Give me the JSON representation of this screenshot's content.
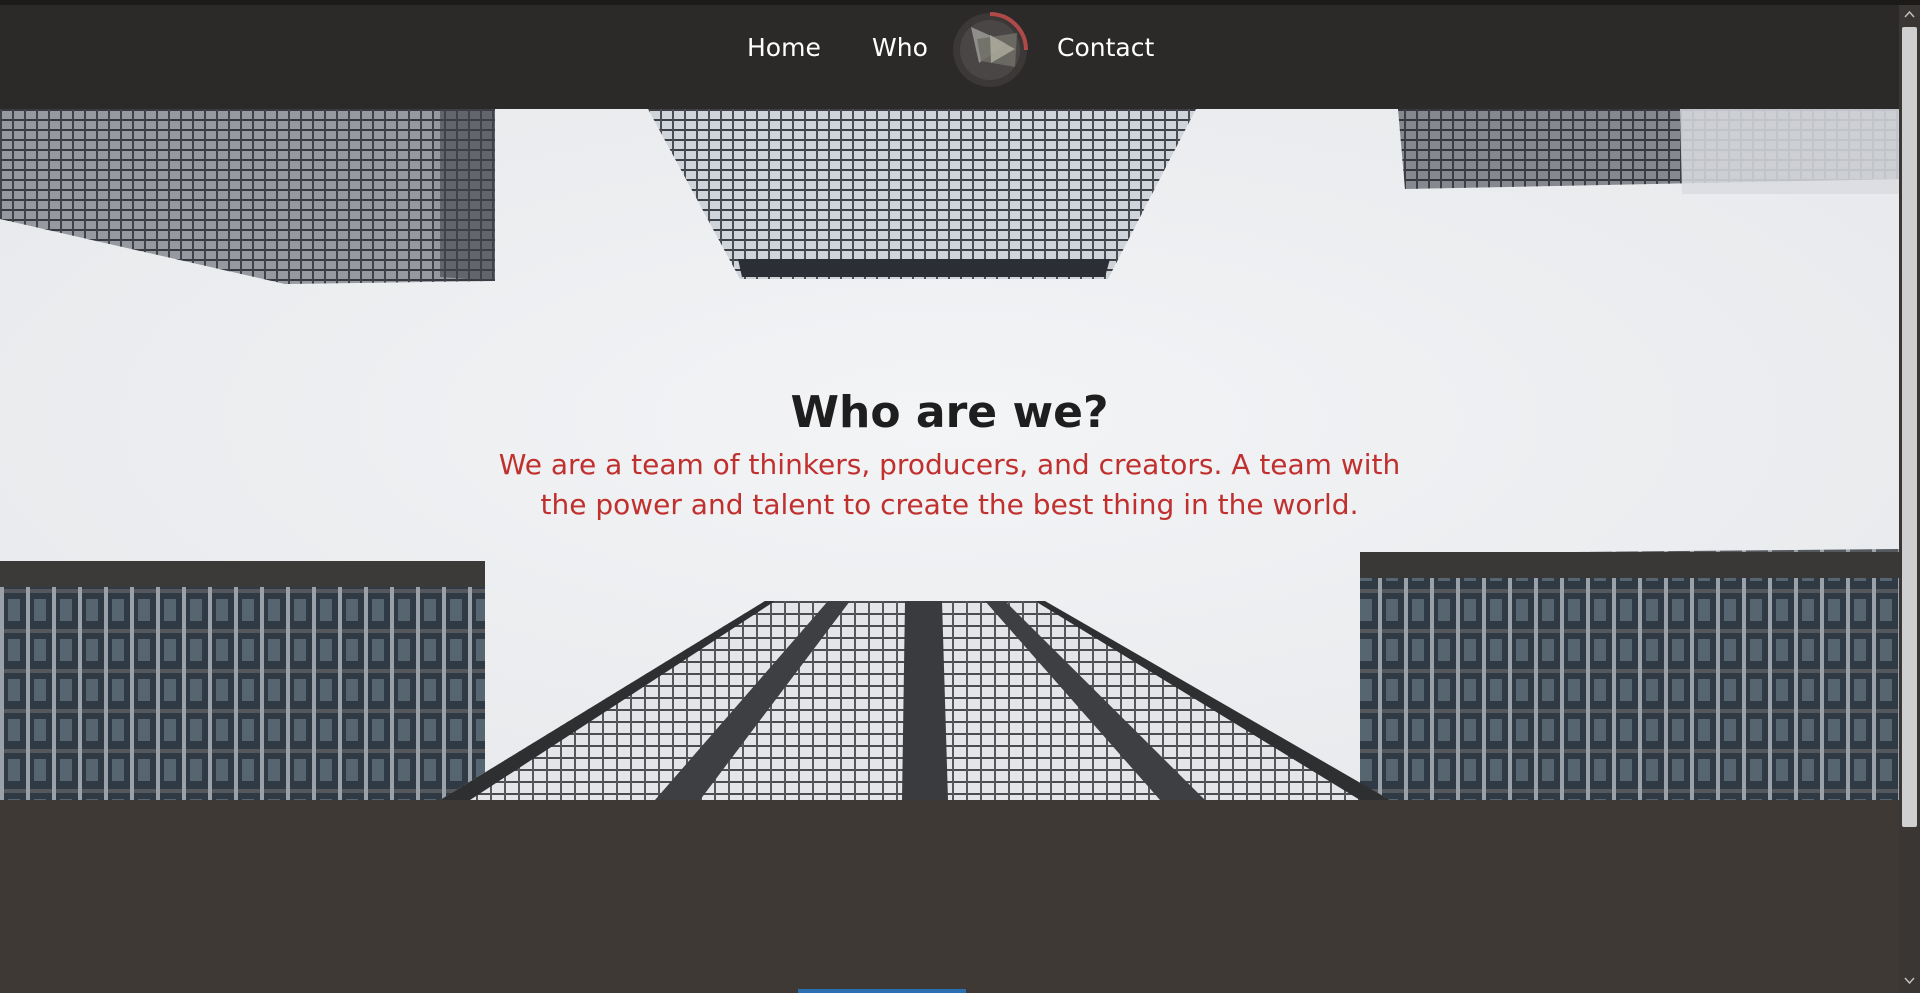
{
  "nav": {
    "items": [
      {
        "label": "Home"
      },
      {
        "label": "Who"
      },
      {
        "label": "Contact"
      }
    ],
    "logo_icon": "play-icon"
  },
  "hero": {
    "title": "Who are we?",
    "subtitle": "We are a team of thinkers, producers, and creators. A team with the power and talent to create the best thing in the world.",
    "background_image": "skyscrapers-looking-up"
  },
  "colors": {
    "navbar": "#2b2a29",
    "page": "#3e3935",
    "accent": "#c0302e",
    "title": "#1e1e1e"
  }
}
